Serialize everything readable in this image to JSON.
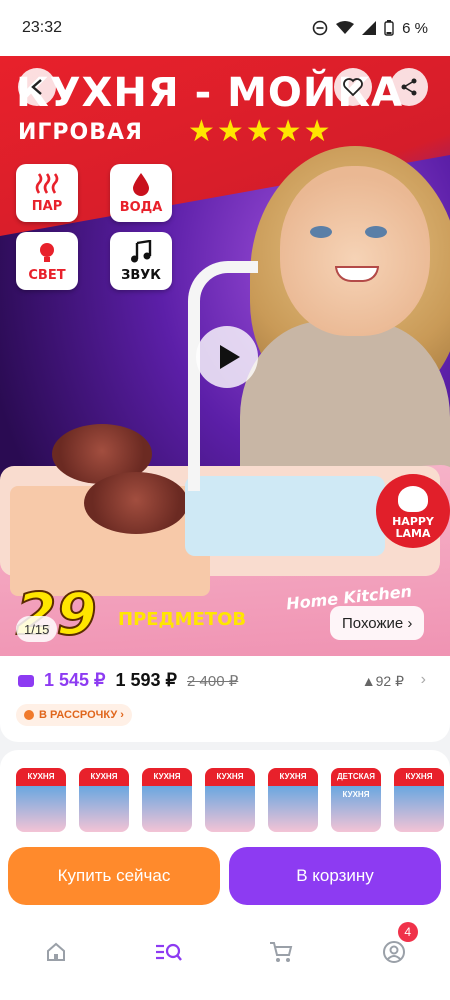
{
  "status": {
    "time": "23:32",
    "battery": "6 %"
  },
  "hero": {
    "title": "КУХНЯ - МОЙКА",
    "subtitle": "ИГРОВАЯ",
    "stars": "★★★★★",
    "features": [
      {
        "label": "ПАР",
        "icon": "steam-icon"
      },
      {
        "label": "ВОДА",
        "icon": "water-drop-icon"
      },
      {
        "label": "СВЕТ",
        "icon": "bulb-icon"
      },
      {
        "label": "ЗВУК",
        "icon": "music-note-icon"
      }
    ],
    "count": "29",
    "count_label": "ПРЕДМЕТОВ",
    "product_line": "Home Kitchen",
    "brand_line1": "HAPPY",
    "brand_line2": "LAMA",
    "page_indicator": "1/15",
    "similar_label": "Похожие ›"
  },
  "price": {
    "card_price": "1 545 ₽",
    "price": "1 593 ₽",
    "old_price": "2 400 ₽",
    "delta": "▲92 ₽",
    "installment": "В РАССРОЧКУ ›"
  },
  "variants": [
    {
      "label": "КУХНЯ"
    },
    {
      "label": "КУХНЯ"
    },
    {
      "label": "КУХНЯ"
    },
    {
      "label": "КУХНЯ"
    },
    {
      "label": "КУХНЯ"
    },
    {
      "label": "ДЕТСКАЯ КУХНЯ"
    },
    {
      "label": "КУХНЯ"
    }
  ],
  "actions": {
    "buy_now": "Купить сейчас",
    "add_to_cart": "В корзину"
  },
  "nav": {
    "profile_badge": "4"
  },
  "colors": {
    "accent": "#8d3bf2",
    "buy": "#ff8a2c",
    "brand_red": "#e8212b"
  }
}
